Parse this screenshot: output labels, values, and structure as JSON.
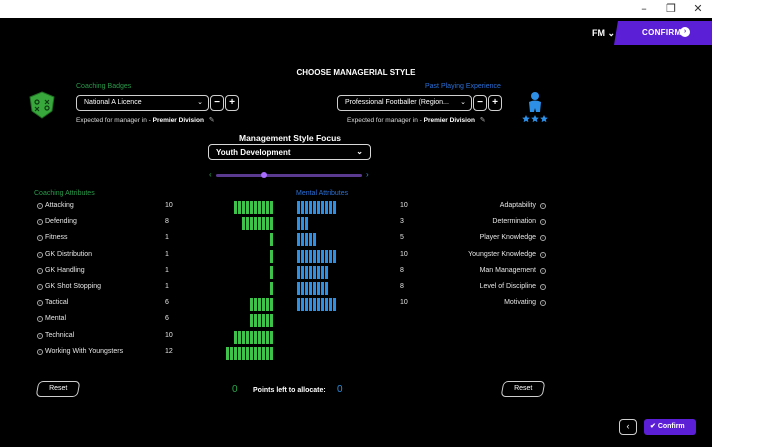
{
  "window": {
    "minimize": "–",
    "maximize": "❐",
    "close": "✕"
  },
  "header": {
    "menu_label": "FM ⌄",
    "confirm_label": "CONFIRM",
    "accent_color": "#5b1fd6"
  },
  "page_title": "CHOOSE MANAGERIAL STYLE",
  "coaching_badges": {
    "label": "Coaching Badges",
    "value": "National A Licence",
    "minus": "−",
    "plus": "+",
    "expected_prefix": "Expected for manager in",
    "expected_sep": "-",
    "expected_value": "Premier Division"
  },
  "past_experience": {
    "label": "Past Playing Experience",
    "value": "Professional Footballer (Region...",
    "minus": "−",
    "plus": "+",
    "expected_prefix": "Expected for manager in",
    "expected_sep": "-",
    "expected_value": "Premier Division"
  },
  "focus": {
    "title": "Management Style Focus",
    "value": "Youth Development",
    "slider_position": 0.32
  },
  "coaching_attributes": {
    "heading": "Coaching Attributes",
    "items": [
      {
        "name": "Attacking",
        "value": 10
      },
      {
        "name": "Defending",
        "value": 8
      },
      {
        "name": "Fitness",
        "value": 1
      },
      {
        "name": "GK Distribution",
        "value": 1
      },
      {
        "name": "GK Handling",
        "value": 1
      },
      {
        "name": "GK Shot Stopping",
        "value": 1
      },
      {
        "name": "Tactical",
        "value": 6
      },
      {
        "name": "Mental",
        "value": 6
      },
      {
        "name": "Technical",
        "value": 10
      },
      {
        "name": "Working With Youngsters",
        "value": 12
      }
    ]
  },
  "mental_attributes": {
    "heading": "Mental Attributes",
    "items": [
      {
        "name": "Adaptability",
        "value": 10
      },
      {
        "name": "Determination",
        "value": 3
      },
      {
        "name": "Player Knowledge",
        "value": 5
      },
      {
        "name": "Youngster Knowledge",
        "value": 10
      },
      {
        "name": "Man Management",
        "value": 8
      },
      {
        "name": "Level of Discipline",
        "value": 8
      },
      {
        "name": "Motivating",
        "value": 10
      }
    ]
  },
  "footer": {
    "reset_left": "Reset",
    "reset_right": "Reset",
    "points_green": "0",
    "points_label": "Points left to allocate:",
    "points_blue": "0",
    "confirm_label": "Confirm"
  },
  "colors": {
    "green": "#3ec24a",
    "blue": "#2d8fe6",
    "purple": "#5b1fd6"
  }
}
